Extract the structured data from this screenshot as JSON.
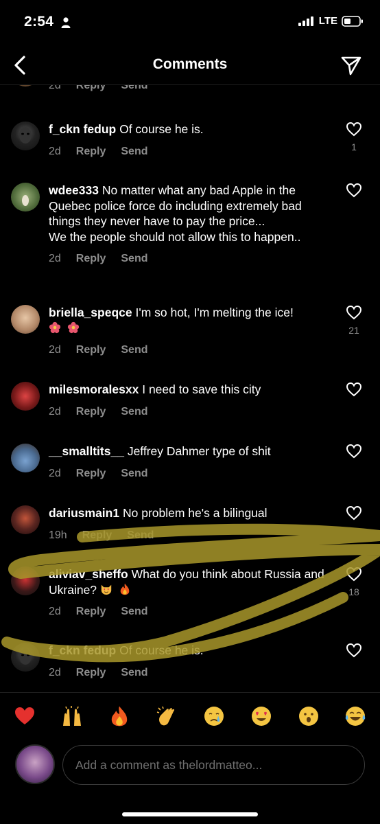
{
  "status_bar": {
    "time": "2:54",
    "network": "LTE"
  },
  "nav": {
    "title": "Comments"
  },
  "partial_comment": {
    "time": "2d",
    "reply": "Reply",
    "send": "Send"
  },
  "comments": [
    {
      "username": "f_ckn fedup",
      "text": "Of course he is.",
      "time": "2d",
      "reply": "Reply",
      "send": "Send",
      "likes": "1"
    },
    {
      "username": "wdee333",
      "text": "No matter what any bad Apple in the Quebec police force do including extremely bad things they never have to pay the price...",
      "text2": "We the people should not allow this to happen..",
      "time": "2d",
      "reply": "Reply",
      "send": "Send",
      "likes": ""
    },
    {
      "username": "briella_speqce",
      "text": "I'm so hot, I'm melting the ice!",
      "time": "2d",
      "reply": "Reply",
      "send": "Send",
      "likes": "21"
    },
    {
      "username": "milesmoralesxx",
      "text": "I need to save this city",
      "time": "2d",
      "reply": "Reply",
      "send": "Send",
      "likes": ""
    },
    {
      "username": "__smalltits__",
      "text": "Jeffrey Dahmer type of shit",
      "time": "2d",
      "reply": "Reply",
      "send": "Send",
      "likes": ""
    },
    {
      "username": "dariusmain1",
      "text": "No problem he's a bilingual",
      "time": "19h",
      "reply": "Reply",
      "send": "Send",
      "likes": ""
    },
    {
      "username": "aliviav_sheffo",
      "text": "What do you think about Russia and Ukraine?",
      "time": "2d",
      "reply": "Reply",
      "send": "Send",
      "likes": "18"
    },
    {
      "username": "f_ckn fedup",
      "text": "Of course he is.",
      "time": "2d",
      "reply": "Reply",
      "send": "Send",
      "likes": ""
    }
  ],
  "reactions": [
    "heart",
    "raised-hands",
    "fire",
    "clapping-hands",
    "crying-face",
    "heart-eyes",
    "surprised-face",
    "tears-of-joy"
  ],
  "composer": {
    "placeholder": "Add a comment as thelordmatteo..."
  },
  "colors": {
    "background": "#000000",
    "secondary_text": "#8e8e8e",
    "highlight_scribble": "#a8972a"
  }
}
